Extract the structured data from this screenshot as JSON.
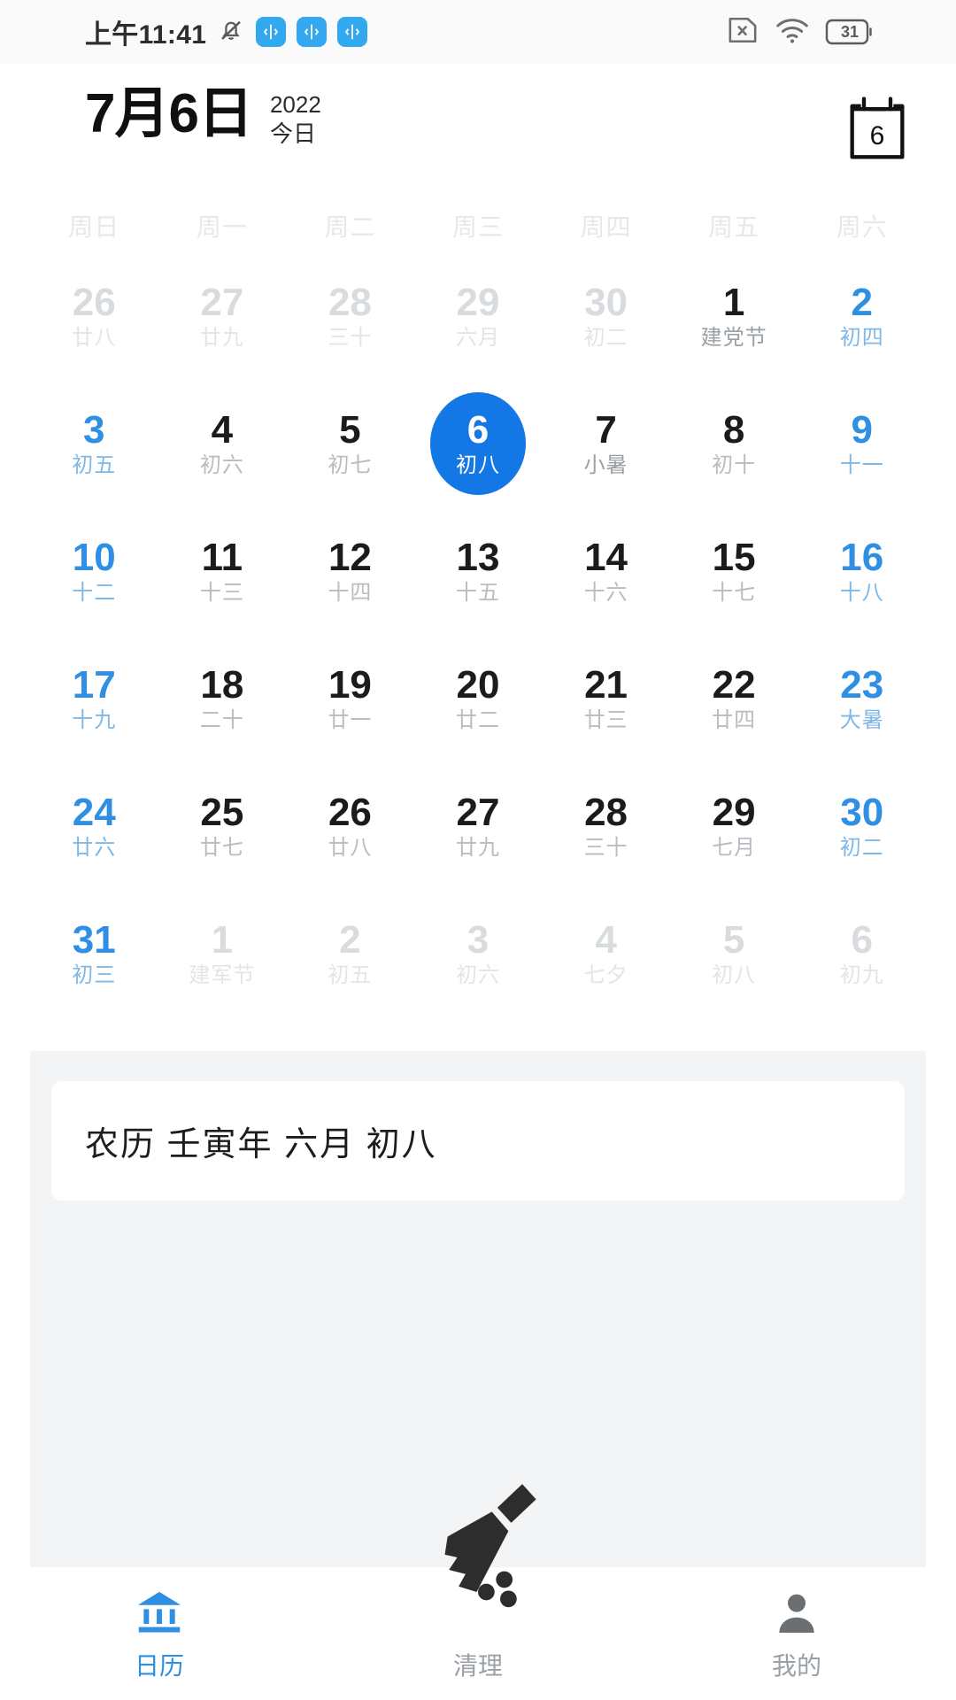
{
  "statusbar": {
    "time": "上午11:41",
    "icons": [
      "bell-muted-icon",
      "badge-blue-1",
      "badge-blue-2",
      "badge-blue-3",
      "sim-x-icon",
      "wifi-icon",
      "battery-icon"
    ],
    "battery_percent": "31"
  },
  "header": {
    "date_title": "7月6日",
    "year": "2022",
    "today_label": "今日",
    "today_icon_day": "6"
  },
  "calendar": {
    "weekdays": [
      "周日",
      "周一",
      "周二",
      "周三",
      "周四",
      "周五",
      "周六"
    ],
    "weeks": [
      [
        {
          "num": "26",
          "lunar": "廿八",
          "state": "muted"
        },
        {
          "num": "27",
          "lunar": "廿九",
          "state": "muted"
        },
        {
          "num": "28",
          "lunar": "三十",
          "state": "muted"
        },
        {
          "num": "29",
          "lunar": "六月",
          "state": "muted"
        },
        {
          "num": "30",
          "lunar": "初二",
          "state": "muted"
        },
        {
          "num": "1",
          "lunar": "建党节",
          "state": "holiday"
        },
        {
          "num": "2",
          "lunar": "初四",
          "state": "weekend"
        }
      ],
      [
        {
          "num": "3",
          "lunar": "初五",
          "state": "weekend"
        },
        {
          "num": "4",
          "lunar": "初六",
          "state": "normal"
        },
        {
          "num": "5",
          "lunar": "初七",
          "state": "normal"
        },
        {
          "num": "6",
          "lunar": "初八",
          "state": "selected"
        },
        {
          "num": "7",
          "lunar": "小暑",
          "state": "holiday"
        },
        {
          "num": "8",
          "lunar": "初十",
          "state": "normal"
        },
        {
          "num": "9",
          "lunar": "十一",
          "state": "weekend"
        }
      ],
      [
        {
          "num": "10",
          "lunar": "十二",
          "state": "weekend"
        },
        {
          "num": "11",
          "lunar": "十三",
          "state": "normal"
        },
        {
          "num": "12",
          "lunar": "十四",
          "state": "normal"
        },
        {
          "num": "13",
          "lunar": "十五",
          "state": "normal"
        },
        {
          "num": "14",
          "lunar": "十六",
          "state": "normal"
        },
        {
          "num": "15",
          "lunar": "十七",
          "state": "normal"
        },
        {
          "num": "16",
          "lunar": "十八",
          "state": "weekend"
        }
      ],
      [
        {
          "num": "17",
          "lunar": "十九",
          "state": "weekend"
        },
        {
          "num": "18",
          "lunar": "二十",
          "state": "normal"
        },
        {
          "num": "19",
          "lunar": "廿一",
          "state": "normal"
        },
        {
          "num": "20",
          "lunar": "廿二",
          "state": "normal"
        },
        {
          "num": "21",
          "lunar": "廿三",
          "state": "normal"
        },
        {
          "num": "22",
          "lunar": "廿四",
          "state": "normal"
        },
        {
          "num": "23",
          "lunar": "大暑",
          "state": "weekend"
        }
      ],
      [
        {
          "num": "24",
          "lunar": "廿六",
          "state": "weekend"
        },
        {
          "num": "25",
          "lunar": "廿七",
          "state": "normal"
        },
        {
          "num": "26",
          "lunar": "廿八",
          "state": "normal"
        },
        {
          "num": "27",
          "lunar": "廿九",
          "state": "normal"
        },
        {
          "num": "28",
          "lunar": "三十",
          "state": "normal"
        },
        {
          "num": "29",
          "lunar": "七月",
          "state": "normal"
        },
        {
          "num": "30",
          "lunar": "初二",
          "state": "weekend"
        }
      ],
      [
        {
          "num": "31",
          "lunar": "初三",
          "state": "weekend"
        },
        {
          "num": "1",
          "lunar": "建军节",
          "state": "muted"
        },
        {
          "num": "2",
          "lunar": "初五",
          "state": "muted"
        },
        {
          "num": "3",
          "lunar": "初六",
          "state": "muted"
        },
        {
          "num": "4",
          "lunar": "七夕",
          "state": "muted"
        },
        {
          "num": "5",
          "lunar": "初八",
          "state": "muted"
        },
        {
          "num": "6",
          "lunar": "初九",
          "state": "muted"
        }
      ]
    ]
  },
  "lunar_panel": {
    "text": "农历 壬寅年 六月 初八"
  },
  "bottomnav": {
    "items": [
      {
        "label": "日历",
        "icon": "calendar-bank-icon",
        "active": true
      },
      {
        "label": "清理",
        "icon": "broom-icon",
        "active": false
      },
      {
        "label": "我的",
        "icon": "person-icon",
        "active": false
      }
    ]
  },
  "colors": {
    "accent": "#2f8fe3",
    "selected": "#1477e6",
    "muted": "#d9dcdf",
    "text": "#1b1b1b"
  }
}
